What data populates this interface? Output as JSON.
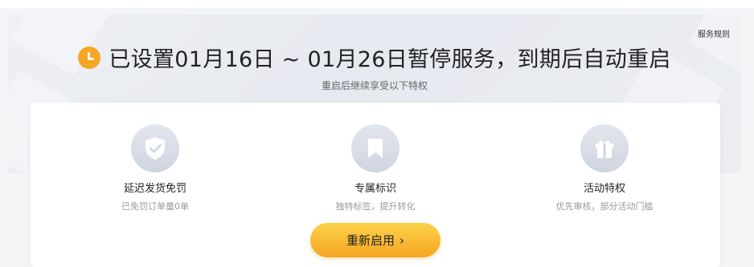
{
  "banner": {
    "rules_link": "服务规则",
    "headline": "已设置01月16日 ~ 01月26日暂停服务，到期后自动重启",
    "subtitle": "重启后继续享受以下特权"
  },
  "features": [
    {
      "title": "延迟发货免罚",
      "desc": "已免罚订单量0单",
      "icon": "shield-check-icon"
    },
    {
      "title": "专属标识",
      "desc": "独特标签，提升转化",
      "icon": "bookmark-icon"
    },
    {
      "title": "活动特权",
      "desc": "优先审核，部分活动门槛",
      "icon": "gift-icon"
    }
  ],
  "action": {
    "restart_label": "重新启用",
    "chevron": "›"
  },
  "colors": {
    "accent": "#f5a623",
    "button_top": "#fcd24a"
  }
}
